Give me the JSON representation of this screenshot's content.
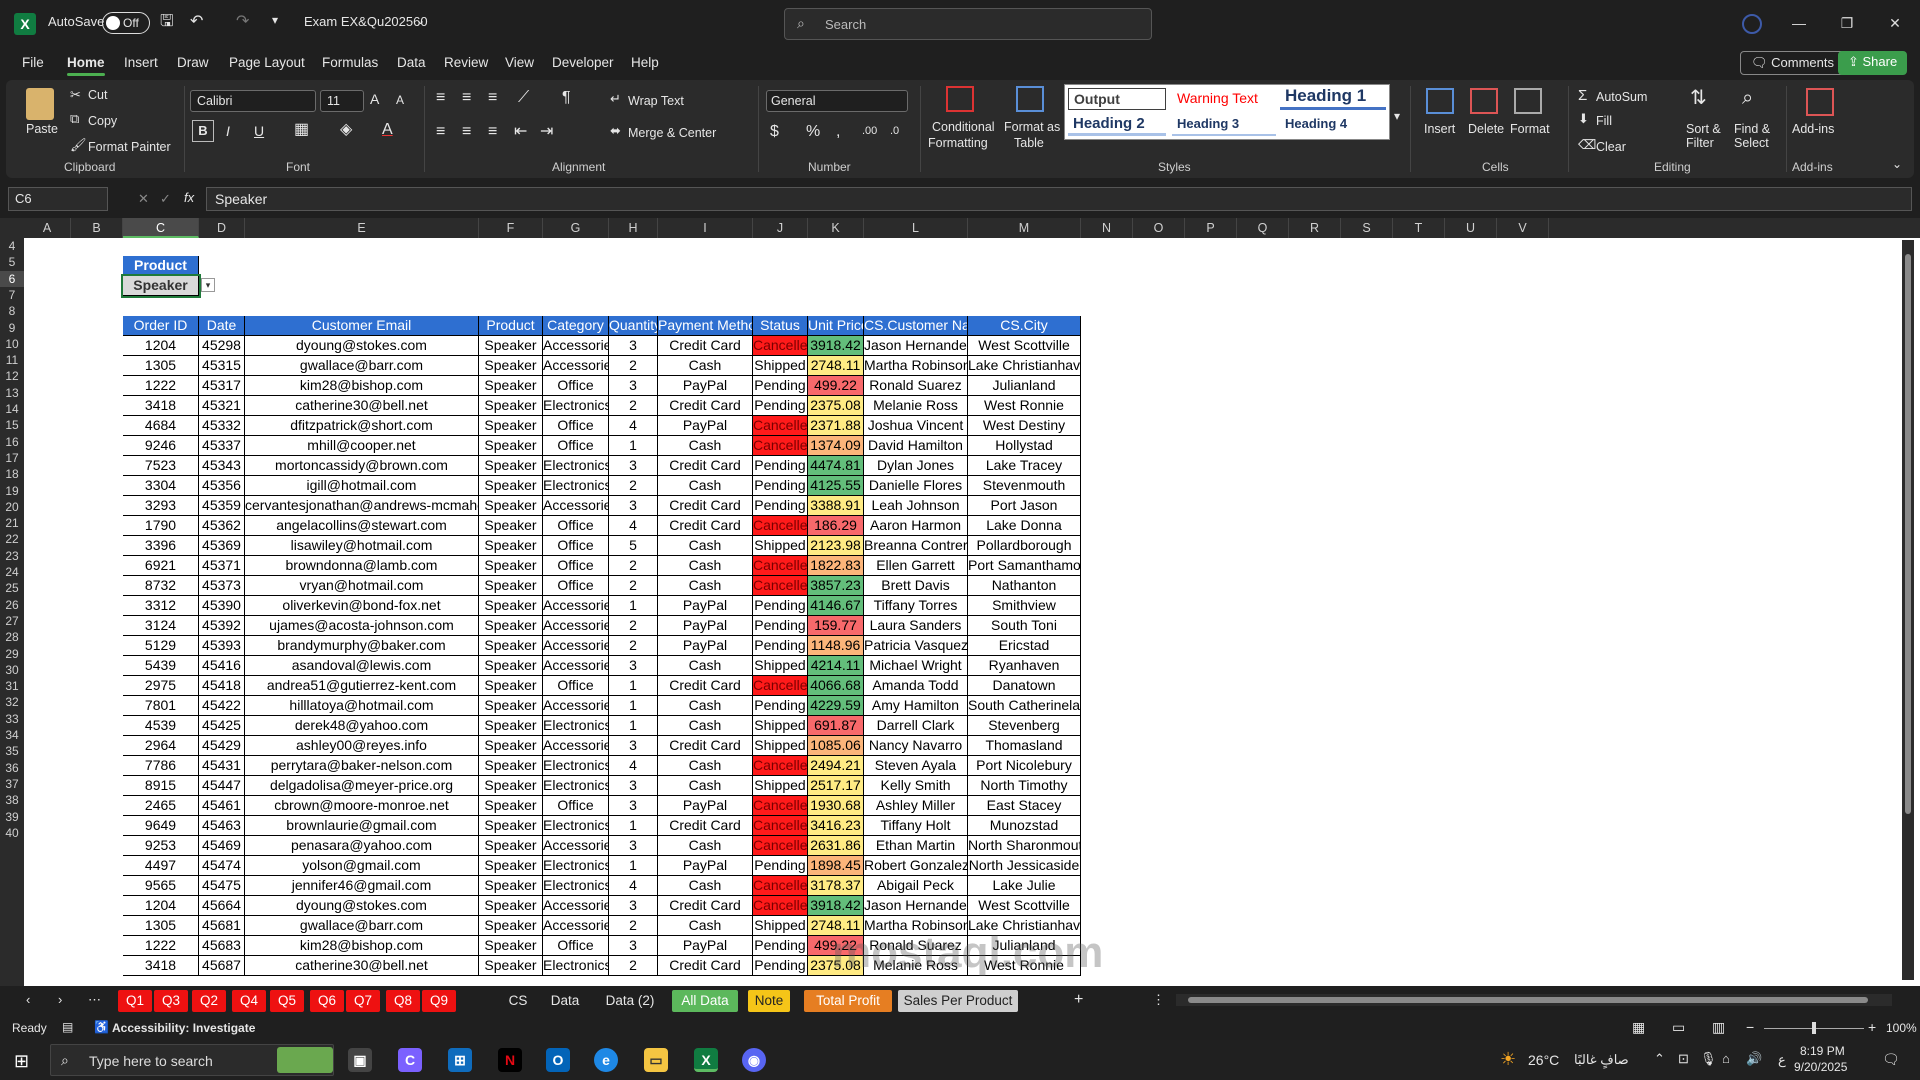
{
  "titlebar": {
    "autosave_label": "AutoSave",
    "autosave_state": "Off",
    "filename": "Exam EX&Qu202560",
    "search_placeholder": "Search"
  },
  "menu": {
    "items": [
      "File",
      "Home",
      "Insert",
      "Draw",
      "Page Layout",
      "Formulas",
      "Data",
      "Review",
      "View",
      "Developer",
      "Help"
    ],
    "comments": "Comments",
    "share": "Share"
  },
  "ribbon": {
    "clipboard": {
      "paste": "Paste",
      "cut": "Cut",
      "copy": "Copy",
      "format_painter": "Format Painter",
      "label": "Clipboard"
    },
    "font": {
      "name": "Calibri",
      "size": "11",
      "label": "Font"
    },
    "alignment": {
      "wrap": "Wrap Text",
      "merge": "Merge & Center",
      "label": "Alignment"
    },
    "number": {
      "format": "General",
      "label": "Number"
    },
    "styles": {
      "conditional": [
        "Conditional",
        "Formatting"
      ],
      "format_table": [
        "Format as",
        "Table"
      ],
      "cells": [
        "Output",
        "Warning Text",
        "Heading 1",
        "Heading 2",
        "Heading 3",
        "Heading 4"
      ],
      "label": "Styles"
    },
    "cells": {
      "insert": "Insert",
      "delete": "Delete",
      "format": "Format",
      "label": "Cells"
    },
    "editing": {
      "autosum": "AutoSum",
      "fill": "Fill",
      "clear": "Clear",
      "sort": [
        "Sort &",
        "Filter"
      ],
      "find": [
        "Find &",
        "Select"
      ],
      "label": "Editing"
    },
    "addins": {
      "label": "Add-ins",
      "button": "Add-ins"
    }
  },
  "formula_bar": {
    "namebox": "C6",
    "formula": "Speaker"
  },
  "columns": [
    "A",
    "B",
    "C",
    "D",
    "E",
    "F",
    "G",
    "H",
    "I",
    "J",
    "K",
    "L",
    "M",
    "N",
    "O",
    "P",
    "Q",
    "R",
    "S",
    "T",
    "U",
    "V"
  ],
  "rows": [
    "4",
    "5",
    "6",
    "7",
    "8",
    "9",
    "10",
    "11",
    "12",
    "13",
    "14",
    "15",
    "16",
    "17",
    "18",
    "19",
    "20",
    "21",
    "22",
    "23",
    "24",
    "25",
    "26",
    "27",
    "28",
    "29",
    "30",
    "31",
    "32",
    "33",
    "34",
    "35",
    "36",
    "37",
    "38",
    "39",
    "40"
  ],
  "filter": {
    "header": "Product",
    "value": "Speaker"
  },
  "table": {
    "headers": [
      "Order ID",
      "Date",
      "Customer Email",
      "Product",
      "Category",
      "Quantity",
      "Payment Method",
      "Status",
      "Unit Price",
      "CS.Customer Name",
      "CS.City"
    ],
    "rows": [
      [
        "1204",
        "45298",
        "dyoung@stokes.com",
        "Speaker",
        "Accessories",
        "3",
        "Credit Card",
        "Cancelled",
        "3918.42",
        "Jason Hernandez",
        "West Scottville"
      ],
      [
        "1305",
        "45315",
        "gwallace@barr.com",
        "Speaker",
        "Accessories",
        "2",
        "Cash",
        "Shipped",
        "2748.11",
        "Martha Robinson",
        "Lake Christianhaven"
      ],
      [
        "1222",
        "45317",
        "kim28@bishop.com",
        "Speaker",
        "Office",
        "3",
        "PayPal",
        "Pending",
        "499.22",
        "Ronald Suarez",
        "Julianland"
      ],
      [
        "3418",
        "45321",
        "catherine30@bell.net",
        "Speaker",
        "Electronics",
        "2",
        "Credit Card",
        "Pending",
        "2375.08",
        "Melanie Ross",
        "West Ronnie"
      ],
      [
        "4684",
        "45332",
        "dfitzpatrick@short.com",
        "Speaker",
        "Office",
        "4",
        "PayPal",
        "Cancelled",
        "2371.88",
        "Joshua Vincent",
        "West Destiny"
      ],
      [
        "9246",
        "45337",
        "mhill@cooper.net",
        "Speaker",
        "Office",
        "1",
        "Cash",
        "Cancelled",
        "1374.09",
        "David Hamilton",
        "Hollystad"
      ],
      [
        "7523",
        "45343",
        "mortoncassidy@brown.com",
        "Speaker",
        "Electronics",
        "3",
        "Credit Card",
        "Pending",
        "4474.81",
        "Dylan Jones",
        "Lake Tracey"
      ],
      [
        "3304",
        "45356",
        "igill@hotmail.com",
        "Speaker",
        "Electronics",
        "2",
        "Cash",
        "Pending",
        "4125.55",
        "Danielle Flores",
        "Stevenmouth"
      ],
      [
        "3293",
        "45359",
        "cervantesjonathan@andrews-mcmahon.net",
        "Speaker",
        "Accessories",
        "3",
        "Credit Card",
        "Pending",
        "3388.91",
        "Leah Johnson",
        "Port Jason"
      ],
      [
        "1790",
        "45362",
        "angelacollins@stewart.com",
        "Speaker",
        "Office",
        "4",
        "Credit Card",
        "Cancelled",
        "186.29",
        "Aaron Harmon",
        "Lake Donna"
      ],
      [
        "3396",
        "45369",
        "lisawiley@hotmail.com",
        "Speaker",
        "Office",
        "5",
        "Cash",
        "Shipped",
        "2123.98",
        "Breanna Contreras",
        "Pollardborough"
      ],
      [
        "6921",
        "45371",
        "browndonna@lamb.com",
        "Speaker",
        "Office",
        "2",
        "Cash",
        "Cancelled",
        "1822.83",
        "Ellen Garrett",
        "Port Samanthamouth"
      ],
      [
        "8732",
        "45373",
        "vryan@hotmail.com",
        "Speaker",
        "Office",
        "2",
        "Cash",
        "Cancelled",
        "3857.23",
        "Brett Davis",
        "Nathanton"
      ],
      [
        "3312",
        "45390",
        "oliverkevin@bond-fox.net",
        "Speaker",
        "Accessories",
        "1",
        "PayPal",
        "Pending",
        "4146.67",
        "Tiffany Torres",
        "Smithview"
      ],
      [
        "3124",
        "45392",
        "ujames@acosta-johnson.com",
        "Speaker",
        "Accessories",
        "2",
        "PayPal",
        "Pending",
        "159.77",
        "Laura Sanders",
        "South Toni"
      ],
      [
        "5129",
        "45393",
        "brandymurphy@baker.com",
        "Speaker",
        "Accessories",
        "2",
        "PayPal",
        "Pending",
        "1148.96",
        "Patricia Vasquez",
        "Ericstad"
      ],
      [
        "5439",
        "45416",
        "asandoval@lewis.com",
        "Speaker",
        "Accessories",
        "3",
        "Cash",
        "Shipped",
        "4214.11",
        "Michael Wright",
        "Ryanhaven"
      ],
      [
        "2975",
        "45418",
        "andrea51@gutierrez-kent.com",
        "Speaker",
        "Office",
        "1",
        "Credit Card",
        "Cancelled",
        "4066.68",
        "Amanda Todd",
        "Danatown"
      ],
      [
        "7801",
        "45422",
        "hilllatoya@hotmail.com",
        "Speaker",
        "Accessories",
        "1",
        "Cash",
        "Pending",
        "4229.59",
        "Amy Hamilton",
        "South Catherineland"
      ],
      [
        "4539",
        "45425",
        "derek48@yahoo.com",
        "Speaker",
        "Electronics",
        "1",
        "Cash",
        "Shipped",
        "691.87",
        "Darrell Clark",
        "Stevenberg"
      ],
      [
        "2964",
        "45429",
        "ashley00@reyes.info",
        "Speaker",
        "Accessories",
        "3",
        "Credit Card",
        "Shipped",
        "1085.06",
        "Nancy Navarro",
        "Thomasland"
      ],
      [
        "7786",
        "45431",
        "perrytara@baker-nelson.com",
        "Speaker",
        "Electronics",
        "4",
        "Cash",
        "Cancelled",
        "2494.21",
        "Steven Ayala",
        "Port Nicolebury"
      ],
      [
        "8915",
        "45447",
        "delgadolisa@meyer-price.org",
        "Speaker",
        "Electronics",
        "3",
        "Cash",
        "Shipped",
        "2517.17",
        "Kelly Smith",
        "North Timothy"
      ],
      [
        "2465",
        "45461",
        "cbrown@moore-monroe.net",
        "Speaker",
        "Office",
        "3",
        "PayPal",
        "Cancelled",
        "1930.68",
        "Ashley Miller",
        "East Stacey"
      ],
      [
        "9649",
        "45463",
        "brownlaurie@gmail.com",
        "Speaker",
        "Electronics",
        "1",
        "Credit Card",
        "Cancelled",
        "3416.23",
        "Tiffany Holt",
        "Munozstad"
      ],
      [
        "9253",
        "45469",
        "penasara@yahoo.com",
        "Speaker",
        "Accessories",
        "3",
        "Cash",
        "Cancelled",
        "2631.86",
        "Ethan Martin",
        "North Sharonmouth"
      ],
      [
        "4497",
        "45474",
        "yolson@gmail.com",
        "Speaker",
        "Electronics",
        "1",
        "PayPal",
        "Pending",
        "1898.45",
        "Robert Gonzalez",
        "North Jessicaside"
      ],
      [
        "9565",
        "45475",
        "jennifer46@gmail.com",
        "Speaker",
        "Electronics",
        "4",
        "Cash",
        "Cancelled",
        "3178.37",
        "Abigail Peck",
        "Lake Julie"
      ],
      [
        "1204",
        "45664",
        "dyoung@stokes.com",
        "Speaker",
        "Accessories",
        "3",
        "Credit Card",
        "Cancelled",
        "3918.42",
        "Jason Hernandez",
        "West Scottville"
      ],
      [
        "1305",
        "45681",
        "gwallace@barr.com",
        "Speaker",
        "Accessories",
        "2",
        "Cash",
        "Shipped",
        "2748.11",
        "Martha Robinson",
        "Lake Christianhaven"
      ],
      [
        "1222",
        "45683",
        "kim28@bishop.com",
        "Speaker",
        "Office",
        "3",
        "PayPal",
        "Pending",
        "499.22",
        "Ronald Suarez",
        "Julianland"
      ],
      [
        "3418",
        "45687",
        "catherine30@bell.net",
        "Speaker",
        "Electronics",
        "2",
        "Credit Card",
        "Pending",
        "2375.08",
        "Melanie Ross",
        "West Ronnie"
      ]
    ]
  },
  "price_colors": {
    "green": "#63be7b",
    "yellow": "#ffeb84",
    "orange": "#fcb57a",
    "red": "#f8696b"
  },
  "tabs": [
    {
      "label": "Q1",
      "style": "red"
    },
    {
      "label": "Q3",
      "style": "red"
    },
    {
      "label": "Q2",
      "style": "red"
    },
    {
      "label": "Q4",
      "style": "red"
    },
    {
      "label": "Q5",
      "style": "red"
    },
    {
      "label": "Q6",
      "style": "red"
    },
    {
      "label": "Q7",
      "style": "red"
    },
    {
      "label": "Q8",
      "style": "red"
    },
    {
      "label": "Q9",
      "style": "red"
    },
    {
      "label": "CS",
      "style": "plain"
    },
    {
      "label": "Data",
      "style": "plain"
    },
    {
      "label": "Data (2)",
      "style": "plain"
    },
    {
      "label": "All Data",
      "style": "green"
    },
    {
      "label": "Note",
      "style": "yellow"
    },
    {
      "label": "Total Profit",
      "style": "orange"
    },
    {
      "label": "Sales Per Product",
      "style": "active"
    }
  ],
  "status": {
    "ready": "Ready",
    "accessibility": "Accessibility: Investigate",
    "zoom": "100%"
  },
  "watermark": "mostaql.com",
  "taskbar": {
    "search": "Type here to search",
    "weather": "26°C",
    "weather_text": "صافٍ غالبًا",
    "time": "8:19 PM",
    "date": "9/20/2025",
    "lang": "ع"
  }
}
